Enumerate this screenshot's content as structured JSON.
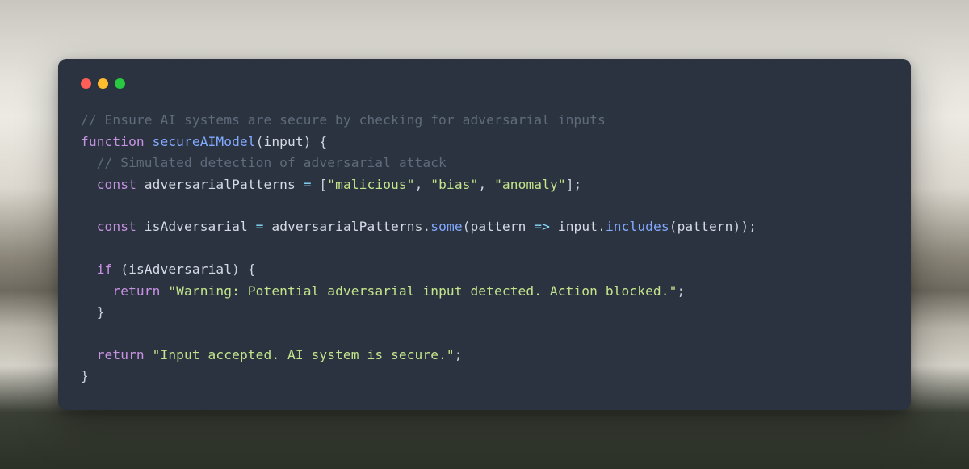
{
  "window": {
    "traffic_lights": [
      "close",
      "minimize",
      "zoom"
    ]
  },
  "code": {
    "l1_comment": "// Ensure AI systems are secure by checking for adversarial inputs",
    "l2": {
      "kw_function": "function",
      "func_name": "secureAIModel",
      "open_paren": "(",
      "param": "input",
      "close_paren_brace": ") {"
    },
    "l3_comment": "  // Simulated detection of adversarial attack",
    "l4": {
      "indent": "  ",
      "kw_const": "const",
      "name": "adversarialPatterns",
      "eq": " = ",
      "lbrack": "[",
      "s1": "\"malicious\"",
      "comma1": ", ",
      "s2": "\"bias\"",
      "comma2": ", ",
      "s3": "\"anomaly\"",
      "rbrack_semi": "];"
    },
    "l6": {
      "indent": "  ",
      "kw_const": "const",
      "name": "isAdversarial",
      "eq": " = ",
      "obj1": "adversarialPatterns",
      "dot1": ".",
      "m_some": "some",
      "open": "(",
      "param": "pattern",
      "arrow": " => ",
      "obj2": "input",
      "dot2": ".",
      "m_includes": "includes",
      "open2": "(",
      "arg": "pattern",
      "close": "));"
    },
    "l8": {
      "indent": "  ",
      "kw_if": "if",
      "open": " (",
      "cond": "isAdversarial",
      "close_brace": ") {"
    },
    "l9": {
      "indent": "    ",
      "kw_return": "return",
      "sp": " ",
      "str": "\"Warning: Potential adversarial input detected. Action blocked.\"",
      "semi": ";"
    },
    "l10": {
      "indent": "  ",
      "close": "}"
    },
    "l12": {
      "indent": "  ",
      "kw_return": "return",
      "sp": " ",
      "str": "\"Input accepted. AI system is secure.\"",
      "semi": ";"
    },
    "l13": {
      "close": "}"
    }
  }
}
